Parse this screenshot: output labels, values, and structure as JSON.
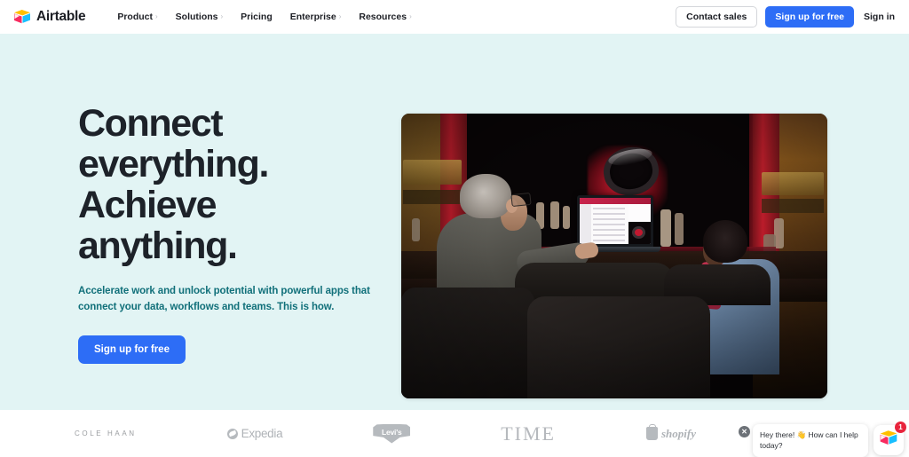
{
  "nav": {
    "logo_text": "Airtable",
    "logo_icon": "airtable-logo-icon",
    "links": [
      {
        "label": "Product",
        "has_chevron": true,
        "chevron": "›"
      },
      {
        "label": "Solutions",
        "has_chevron": true,
        "chevron": "›"
      },
      {
        "label": "Pricing",
        "has_chevron": false,
        "chevron": ""
      },
      {
        "label": "Enterprise",
        "has_chevron": true,
        "chevron": "›"
      },
      {
        "label": "Resources",
        "has_chevron": true,
        "chevron": "›"
      }
    ],
    "contact_sales_label": "Contact sales",
    "signup_label": "Sign up for free",
    "signin_label": "Sign in"
  },
  "hero": {
    "heading_line1": "Connect",
    "heading_line2": "everything.",
    "heading_line3": "Achieve",
    "heading_line4": "anything.",
    "subheading": "Accelerate work and unlock potential with powerful apps that connect your data, workflows and teams. This is how.",
    "cta_label": "Sign up for free",
    "background_color": "#e2f4f4",
    "heading_color": "#1d2229",
    "subheading_color": "#11707a",
    "cta_color": "#2d6df6",
    "image_alt": "Two colleagues seated in a theater auditorium reviewing an Airtable base on a laptop, with a large red smartwatch image projected on the stage screen"
  },
  "logo_strip": {
    "brands": [
      {
        "name": "Cole Haan",
        "display": "COLE HAAN",
        "icon": ""
      },
      {
        "name": "Expedia",
        "display": "Expedia",
        "icon": "expedia-globe-icon"
      },
      {
        "name": "Levi's",
        "display": "Levi's",
        "icon": "levis-batwing-icon"
      },
      {
        "name": "TIME",
        "display": "TIME",
        "icon": ""
      },
      {
        "name": "Shopify",
        "display": "shopify",
        "icon": "shopify-bag-icon"
      }
    ]
  },
  "chat_widget": {
    "message": "Hey there! 👋 How can I help today?",
    "close_label": "✕",
    "badge_count": "1",
    "launcher_icon": "airtable-logo-icon",
    "badge_color": "#e8243c"
  }
}
